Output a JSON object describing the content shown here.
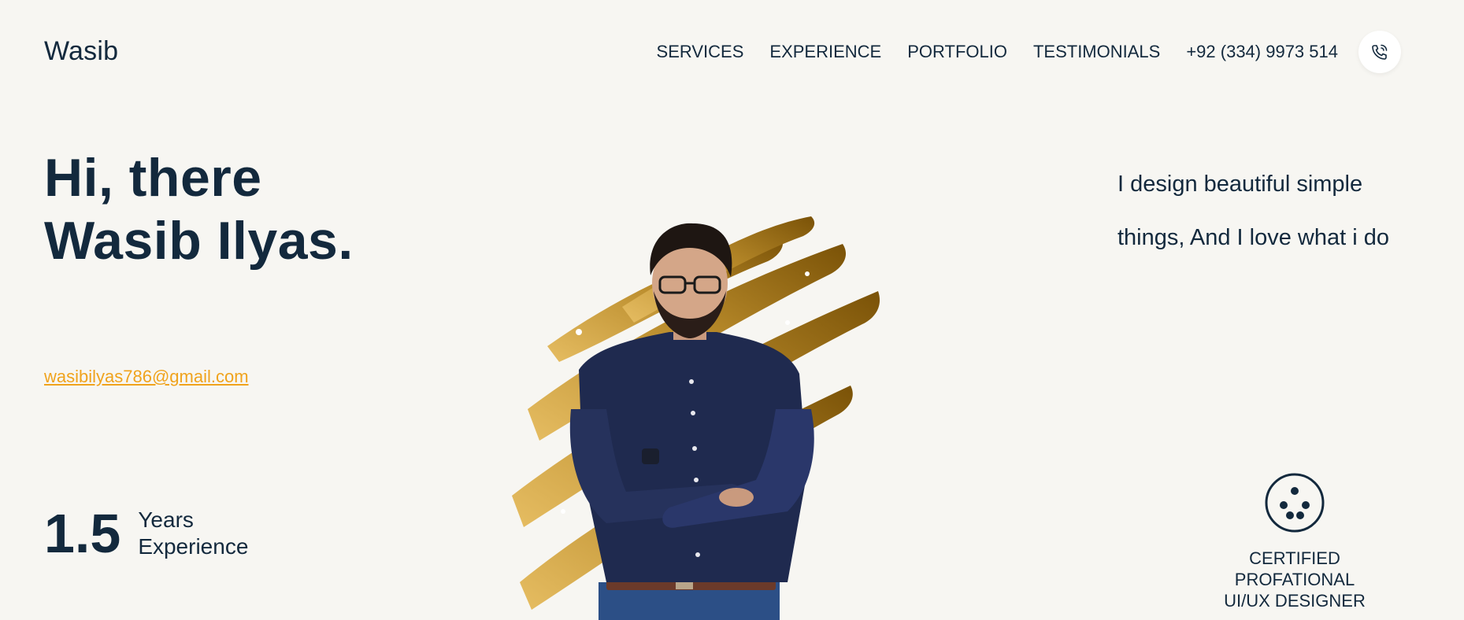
{
  "header": {
    "logo": "Wasib",
    "nav": [
      "SERVICES",
      "EXPERIENCE",
      "PORTFOLIO",
      "TESTIMONIALS"
    ],
    "phone": "+92 (334) 9973 514",
    "phone_icon": "phone-icon"
  },
  "hero": {
    "greeting": "Hi, there",
    "name": "Wasib Ilyas.",
    "email": "wasibilyas786@gmail.com",
    "tagline_line1": "I design beautiful simple",
    "tagline_line2": "things, And I love what i do",
    "experience_value": "1.5",
    "experience_line1": "Years",
    "experience_line2": "Experience"
  },
  "badge": {
    "icon": "certificate-icon",
    "line1": "CERTIFIED PROFATIONAL",
    "line2": "UI/UX DESIGNER"
  },
  "colors": {
    "text": "#13293d",
    "accent": "#f0a31d",
    "background": "#f7f6f2",
    "brush": "#b8860b"
  }
}
